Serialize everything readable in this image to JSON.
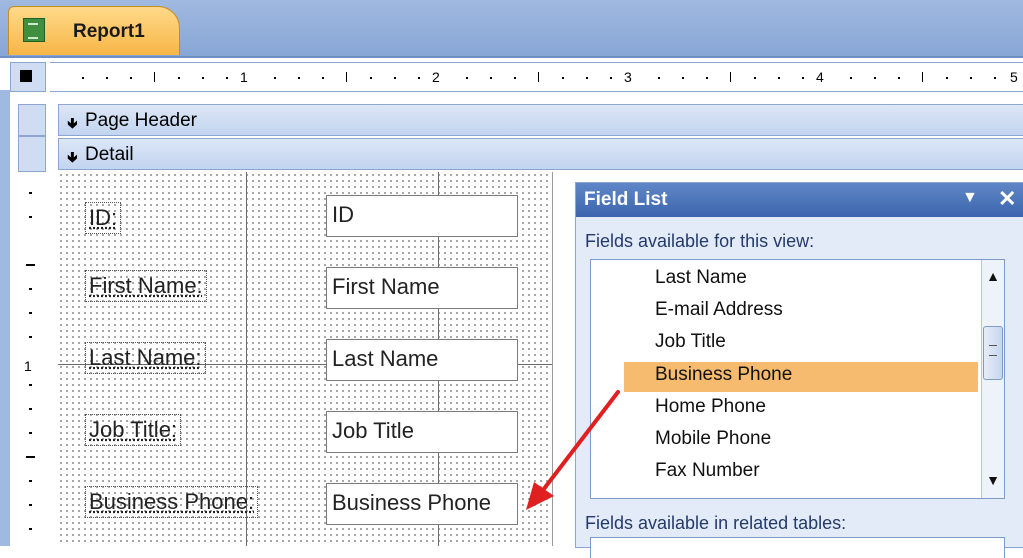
{
  "document_tab": {
    "label": "Report1"
  },
  "ruler": {
    "marks": [
      "1",
      "2",
      "3",
      "4",
      "5"
    ]
  },
  "vertical_ruler": {
    "marks": [
      "1"
    ]
  },
  "sections": {
    "page_header": "Page Header",
    "detail": "Detail"
  },
  "controls": [
    {
      "label": "ID:",
      "textbox": "ID"
    },
    {
      "label": "First Name:",
      "textbox": "First Name"
    },
    {
      "label": "Last Name:",
      "textbox": "Last Name"
    },
    {
      "label": "Job Title:",
      "textbox": "Job Title"
    },
    {
      "label": "Business Phone:",
      "textbox": "Business Phone"
    }
  ],
  "field_list": {
    "title": "Field List",
    "close_glyph": "✕",
    "dropdown_glyph": "▼",
    "available_heading": "Fields available for this view:",
    "fields": [
      "Last Name",
      "E-mail Address",
      "Job Title",
      "Business Phone",
      "Home Phone",
      "Mobile Phone",
      "Fax Number"
    ],
    "selected_field": "Business Phone",
    "related_heading": "Fields available in related tables:"
  },
  "colors": {
    "selection": "#f7bb70",
    "tab": "#f7b646",
    "pane_header": "#3d65ad",
    "arrow": "#e02020"
  }
}
